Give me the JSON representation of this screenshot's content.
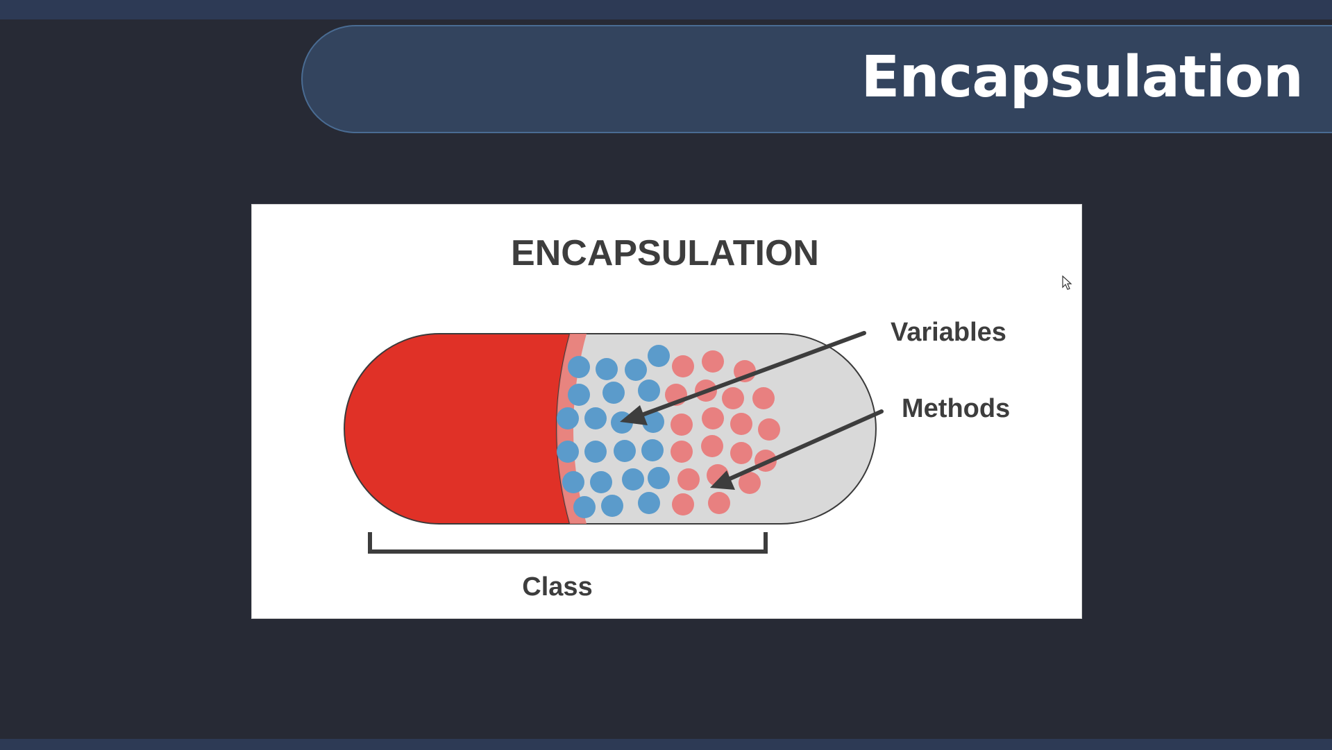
{
  "slide": {
    "title": "Encapsulation"
  },
  "figure": {
    "heading": "ENCAPSULATION",
    "labels": {
      "variables": "Variables",
      "methods": "Methods",
      "class": "Class"
    },
    "colors": {
      "capsule_red": "#e03127",
      "capsule_body": "#d9d9d9",
      "variable_dot": "#5b9bcb",
      "method_dot": "#e88080",
      "text": "#3d3d3d"
    }
  },
  "icons": [
    "cursor-arrow-icon"
  ]
}
